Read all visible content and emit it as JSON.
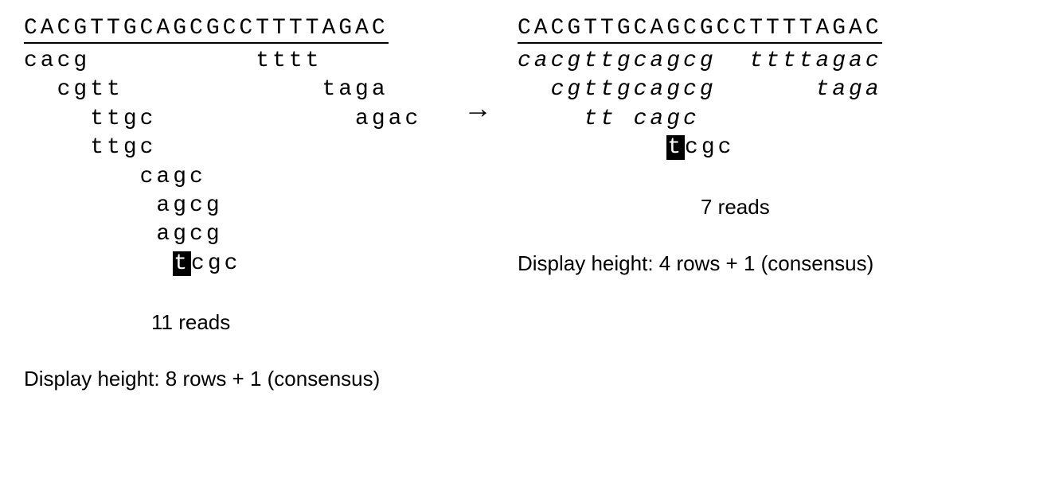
{
  "consensus": "CACGTTGCAGCGCCTTTTAGAC",
  "arrow": "→",
  "left": {
    "reads_rows": [
      {
        "segments": [
          {
            "text": "cacg          tttt"
          }
        ]
      },
      {
        "segments": [
          {
            "text": "  cgtt            taga"
          }
        ]
      },
      {
        "segments": [
          {
            "text": "    ttgc            agac"
          }
        ]
      },
      {
        "segments": [
          {
            "text": "    ttgc"
          }
        ]
      },
      {
        "segments": [
          {
            "text": "       cagc"
          }
        ]
      },
      {
        "segments": [
          {
            "text": "        agcg"
          }
        ]
      },
      {
        "segments": [
          {
            "text": "        agcg"
          }
        ]
      },
      {
        "segments": [
          {
            "text": "         "
          },
          {
            "text": "t",
            "hl": true
          },
          {
            "text": "cgc"
          }
        ]
      }
    ],
    "reads_count": "11 reads",
    "display_height": "Display height: 8 rows + 1 (consensus)"
  },
  "right": {
    "reads_rows": [
      {
        "segments": [
          {
            "text": "cacgttgcagcg  ttttagac",
            "italic": true
          }
        ]
      },
      {
        "segments": [
          {
            "text": "  cgttgcagcg      taga",
            "italic": true
          }
        ]
      },
      {
        "segments": [
          {
            "text": "    tt cagc",
            "italic": true
          }
        ]
      },
      {
        "segments": [
          {
            "text": "         "
          },
          {
            "text": "t",
            "hl": true
          },
          {
            "text": "cgc"
          }
        ]
      }
    ],
    "reads_count": "7 reads",
    "display_height": "Display height: 4 rows + 1 (consensus)"
  }
}
